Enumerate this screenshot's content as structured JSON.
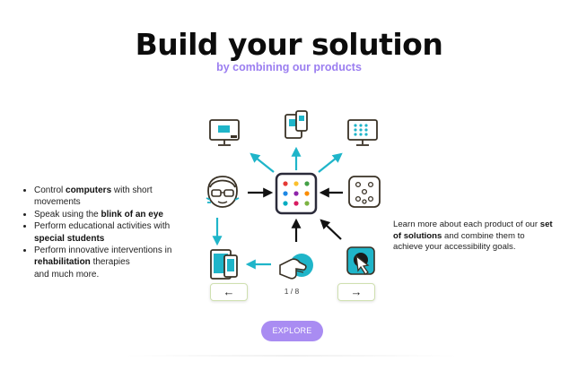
{
  "header": {
    "title": "Build your solution",
    "subtitle": "by combining our products"
  },
  "features": [
    {
      "before": "Control ",
      "bold": "computers",
      "after": " with short movements"
    },
    {
      "before": "Speak using the ",
      "bold": "blink of an eye",
      "after": ""
    },
    {
      "before": "Perform educational activities with ",
      "bold": "special students",
      "after": ""
    },
    {
      "before": "Perform innovative interventions in ",
      "bold": "rehabilitation",
      "after": " therapies"
    },
    {
      "before": "and much more.",
      "bold": "",
      "after": ""
    }
  ],
  "info": {
    "before": "Learn more about each product of our ",
    "bold": "set of solutions",
    "after": " and combine them to achieve your accessibility goals."
  },
  "carousel": {
    "prev_label": "←",
    "next_label": "→",
    "counter": "1 / 8"
  },
  "cta": {
    "explore_label": "EXPLORE"
  },
  "diagram": {
    "hub_icon": "dot-grid-hub-icon",
    "devices": [
      "computer-monitor-icon",
      "tablet-phone-icon",
      "monitor-grid-icon",
      "face-glasses-icon",
      "dot-board-icon",
      "tablet-abc-icon",
      "hand-sensor-icon",
      "touch-button-icon"
    ],
    "hub_dot_colors": [
      "#e53935",
      "#fbc02d",
      "#43a047",
      "#1e88e5",
      "#8e24aa",
      "#fb8c00",
      "#00acc1",
      "#d81b60",
      "#7cb342"
    ],
    "arrow_color_teal": "#1fb5c9",
    "arrow_color_black": "#111111"
  }
}
